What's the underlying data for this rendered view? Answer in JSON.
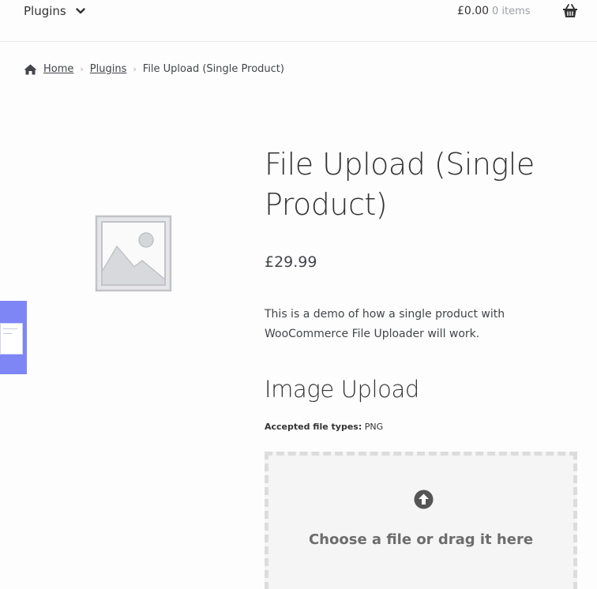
{
  "header": {
    "nav_label": "Plugins",
    "cart_total": "£0.00",
    "cart_count": "0 items"
  },
  "breadcrumb": {
    "home": "Home",
    "plugins": "Plugins",
    "current": "File Upload (Single Product)"
  },
  "product": {
    "title": "File Upload (Single Product)",
    "price": "£29.99",
    "description": "This is a demo of how a single product with WooCommerce File Uploader will work."
  },
  "upload": {
    "heading": "Image Upload",
    "accepted_label": "Accepted file types:",
    "accepted_value": "PNG",
    "dropzone_text": "Choose a file or drag it here"
  },
  "colors": {
    "accent": "#7e86f6",
    "text": "#43454b",
    "muted": "#9aa0a6"
  },
  "icons": {
    "nav_chevron": "chevron-down-icon",
    "cart": "basket-icon",
    "home": "home-icon",
    "placeholder": "image-placeholder-icon",
    "upload": "upload-arrow-icon"
  }
}
